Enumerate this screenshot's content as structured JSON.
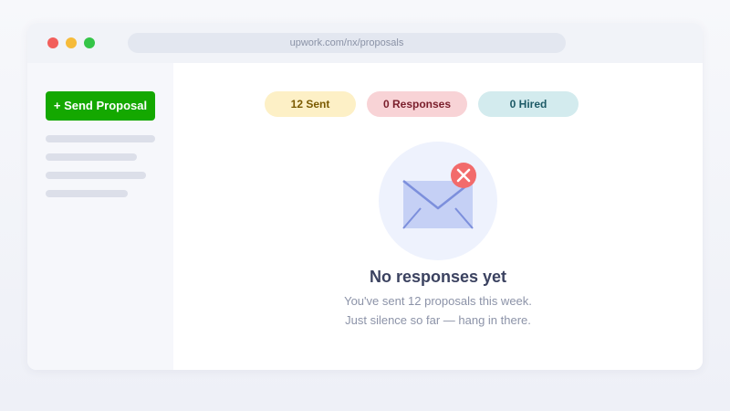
{
  "browser": {
    "url": "upwork.com/nx/proposals"
  },
  "sidebar": {
    "send_button_label": "+ Send Proposal"
  },
  "stats": {
    "sent": "12 Sent",
    "responses": "0 Responses",
    "hired": "0 Hired"
  },
  "empty_state": {
    "title": "No responses yet",
    "line1": "You've sent 12 proposals this week.",
    "line2": "Just silence so far — hang in there."
  },
  "icons": {
    "illustration": "envelope-icon",
    "badge": "close-icon"
  },
  "colors": {
    "brand_green": "#14a800",
    "badge_red": "#f26b6b",
    "envelope": "#c5d0f5"
  }
}
